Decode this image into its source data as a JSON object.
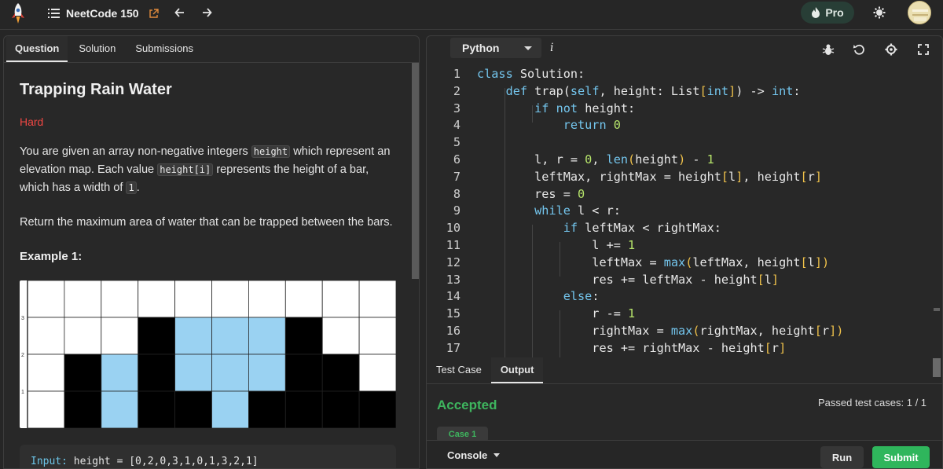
{
  "topbar": {
    "list_title": "NeetCode 150",
    "pro_label": "Pro"
  },
  "left": {
    "tabs": [
      {
        "label": "Question"
      },
      {
        "label": "Solution"
      },
      {
        "label": "Submissions"
      }
    ],
    "title": "Trapping Rain Water",
    "difficulty": "Hard",
    "para1": {
      "t1": "You are given an array non-negative integers ",
      "c1": "height",
      "t2": " which represent an elevation map. Each value ",
      "c2": "height[i]",
      "t3": " represents the height of a bar, which has a width of ",
      "c3": "1",
      "t4": "."
    },
    "para2": "Return the maximum area of water that can be trapped between the bars.",
    "example_heading": "Example 1:",
    "grid_labels": [
      "3",
      "2",
      "1"
    ],
    "heights": [
      0,
      2,
      0,
      3,
      1,
      0,
      1,
      3,
      2,
      1
    ],
    "input_line": {
      "key": "Input:",
      "rest": " height = [0,2,0,3,1,0,1,3,2,1]"
    }
  },
  "editor": {
    "language": "Python",
    "info": "i",
    "colors": {
      "keyword": "#74c6ee",
      "number": "#b5e36a",
      "bracket": "#f0c24b",
      "accepted": "#3eb55e",
      "submit": "#2fb65c",
      "water": "#9ad2f2"
    },
    "lines": [
      {
        "n": "1",
        "code": [
          [
            "kw",
            "class"
          ],
          [
            "t",
            " Solution:"
          ]
        ]
      },
      {
        "n": "2",
        "code": [
          [
            "t",
            "    "
          ],
          [
            "kw",
            "def"
          ],
          [
            "t",
            " trap("
          ],
          [
            "kw",
            "self"
          ],
          [
            "t",
            ", height: List"
          ],
          [
            "br",
            "["
          ],
          [
            "kw",
            "int"
          ],
          [
            "br",
            "]"
          ],
          [
            "t",
            ") -> "
          ],
          [
            "kw",
            "int"
          ],
          [
            "t",
            ":"
          ]
        ]
      },
      {
        "n": "3",
        "code": [
          [
            "t",
            "        "
          ],
          [
            "kw",
            "if"
          ],
          [
            "t",
            " "
          ],
          [
            "kw",
            "not"
          ],
          [
            "t",
            " height:"
          ]
        ]
      },
      {
        "n": "4",
        "code": [
          [
            "t",
            "            "
          ],
          [
            "kw",
            "return"
          ],
          [
            "t",
            " "
          ],
          [
            "num",
            "0"
          ]
        ]
      },
      {
        "n": "5",
        "code": []
      },
      {
        "n": "6",
        "code": [
          [
            "t",
            "        l, r = "
          ],
          [
            "num",
            "0"
          ],
          [
            "t",
            ", "
          ],
          [
            "kw",
            "len"
          ],
          [
            "br",
            "("
          ],
          [
            "t",
            "height"
          ],
          [
            "br",
            ")"
          ],
          [
            "t",
            " - "
          ],
          [
            "num",
            "1"
          ]
        ]
      },
      {
        "n": "7",
        "code": [
          [
            "t",
            "        leftMax, rightMax = height"
          ],
          [
            "br",
            "["
          ],
          [
            "t",
            "l"
          ],
          [
            "br",
            "]"
          ],
          [
            "t",
            ", height"
          ],
          [
            "br",
            "["
          ],
          [
            "t",
            "r"
          ],
          [
            "br",
            "]"
          ]
        ]
      },
      {
        "n": "8",
        "code": [
          [
            "t",
            "        res = "
          ],
          [
            "num",
            "0"
          ]
        ]
      },
      {
        "n": "9",
        "code": [
          [
            "t",
            "        "
          ],
          [
            "kw",
            "while"
          ],
          [
            "t",
            " l < r:"
          ]
        ]
      },
      {
        "n": "10",
        "code": [
          [
            "t",
            "            "
          ],
          [
            "kw",
            "if"
          ],
          [
            "t",
            " leftMax < rightMax:"
          ]
        ]
      },
      {
        "n": "11",
        "code": [
          [
            "t",
            "                l += "
          ],
          [
            "num",
            "1"
          ]
        ]
      },
      {
        "n": "12",
        "code": [
          [
            "t",
            "                leftMax = "
          ],
          [
            "kw",
            "max"
          ],
          [
            "br",
            "("
          ],
          [
            "t",
            "leftMax, height"
          ],
          [
            "br",
            "["
          ],
          [
            "t",
            "l"
          ],
          [
            "br",
            "])"
          ]
        ]
      },
      {
        "n": "13",
        "code": [
          [
            "t",
            "                res += leftMax - height"
          ],
          [
            "br",
            "["
          ],
          [
            "t",
            "l"
          ],
          [
            "br",
            "]"
          ]
        ]
      },
      {
        "n": "14",
        "code": [
          [
            "t",
            "            "
          ],
          [
            "kw",
            "else"
          ],
          [
            "t",
            ":"
          ]
        ]
      },
      {
        "n": "15",
        "code": [
          [
            "t",
            "                r -= "
          ],
          [
            "num",
            "1"
          ]
        ]
      },
      {
        "n": "16",
        "code": [
          [
            "t",
            "                rightMax = "
          ],
          [
            "kw",
            "max"
          ],
          [
            "br",
            "("
          ],
          [
            "t",
            "rightMax, height"
          ],
          [
            "br",
            "["
          ],
          [
            "t",
            "r"
          ],
          [
            "br",
            "])"
          ]
        ]
      },
      {
        "n": "17",
        "code": [
          [
            "t",
            "                res += rightMax - height"
          ],
          [
            "br",
            "["
          ],
          [
            "t",
            "r"
          ],
          [
            "br",
            "]"
          ]
        ]
      }
    ]
  },
  "result": {
    "tabs": [
      {
        "label": "Test Case"
      },
      {
        "label": "Output"
      }
    ],
    "status": "Accepted",
    "passed": "Passed test cases: 1 / 1",
    "case_label": "Case 1"
  },
  "footer": {
    "console_label": "Console",
    "run_label": "Run",
    "submit_label": "Submit"
  }
}
